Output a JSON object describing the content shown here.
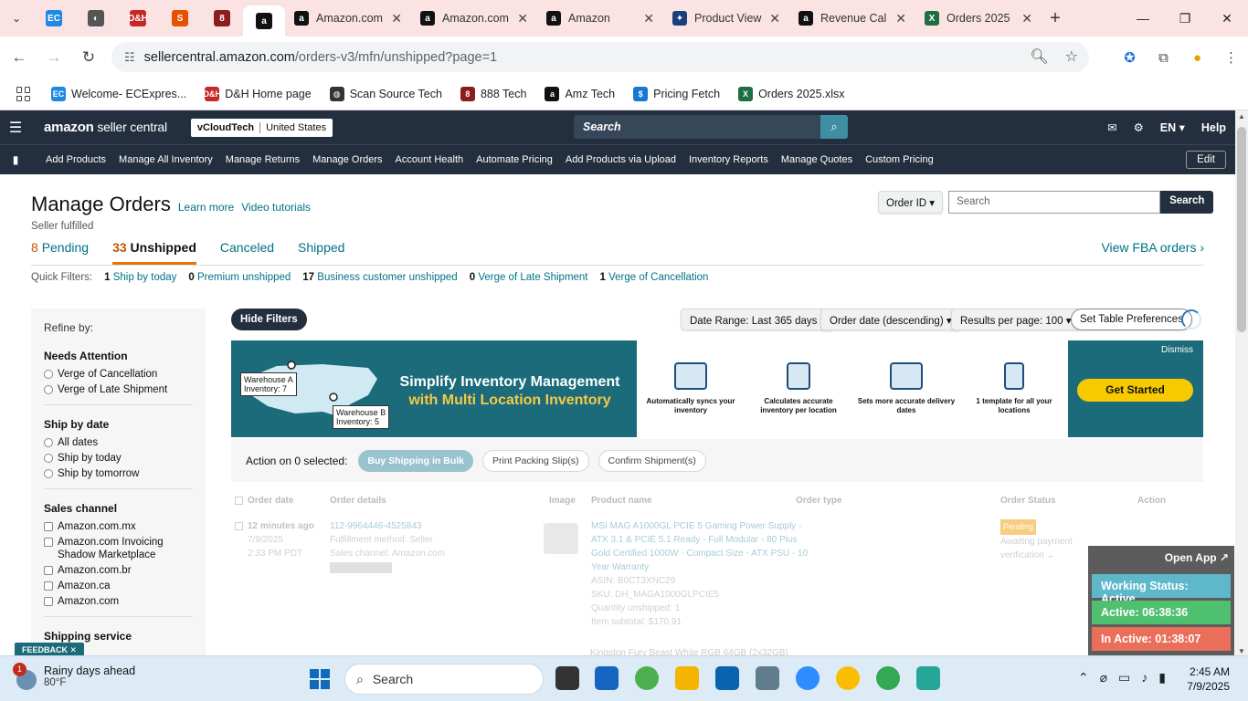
{
  "browser": {
    "pinned_tabs": [
      {
        "icon": "ecexpress-icon",
        "color": "#1e88e5",
        "glyph": "EC"
      },
      {
        "icon": "chrome-globe-icon",
        "color": "#555555",
        "glyph": "◐"
      },
      {
        "icon": "dh-icon",
        "color": "#c62828",
        "glyph": "D&H"
      },
      {
        "icon": "script-icon",
        "color": "#e65100",
        "glyph": "S"
      },
      {
        "icon": "888-icon",
        "color": "#8d1d1d",
        "glyph": "8"
      },
      {
        "icon": "amazon-icon",
        "color": "#111111",
        "glyph": "a"
      }
    ],
    "tabs": [
      {
        "title": "Amazon.com",
        "icon": "amazon-icon"
      },
      {
        "title": "Amazon.com",
        "icon": "amazon-icon"
      },
      {
        "title": "Amazon",
        "icon": "amazon-icon"
      },
      {
        "title": "Product View",
        "icon": "product-view-icon"
      },
      {
        "title": "Revenue Cal",
        "icon": "amazon-icon"
      },
      {
        "title": "Orders 2025",
        "icon": "excel-icon"
      }
    ],
    "url_host": "sellercentral.amazon.com",
    "url_path": "/orders-v3/mfn/unshipped?page=1",
    "bookmarks": [
      {
        "label": "Welcome- ECExpres...",
        "icon": "ecexpress-icon",
        "color": "#1e88e5",
        "glyph": "EC"
      },
      {
        "label": "D&H Home page",
        "icon": "dh-icon",
        "color": "#c62828",
        "glyph": "D&H"
      },
      {
        "label": "Scan Source Tech",
        "icon": "globe-icon",
        "color": "#333333",
        "glyph": "◍"
      },
      {
        "label": "888 Tech",
        "icon": "888-icon",
        "color": "#8d1d1d",
        "glyph": "8"
      },
      {
        "label": "Amz Tech",
        "icon": "amazon-icon",
        "color": "#111111",
        "glyph": "a"
      },
      {
        "label": "Pricing Fetch",
        "icon": "pricing-icon",
        "color": "#1976d2",
        "glyph": "$"
      },
      {
        "label": "Orders 2025.xlsx",
        "icon": "excel-icon",
        "color": "#1d6f42",
        "glyph": "X"
      }
    ]
  },
  "seller_central": {
    "logo_bold": "amazon",
    "logo_sub": " seller central",
    "account": "vCloudTech",
    "marketplace": "United States",
    "search_placeholder": "Search",
    "language": "EN",
    "help": "Help",
    "nav": [
      "Add Products",
      "Manage All Inventory",
      "Manage Returns",
      "Manage Orders",
      "Account Health",
      "Automate Pricing",
      "Add Products via Upload",
      "Inventory Reports",
      "Manage Quotes",
      "Custom Pricing"
    ],
    "edit": "Edit"
  },
  "page": {
    "title": "Manage Orders",
    "learn_more": "Learn more",
    "video_tutorials": "Video tutorials",
    "subtitle": "Seller fulfilled",
    "search_type": "Order ID",
    "search_placeholder": "Search",
    "search_button": "Search",
    "tabs": [
      {
        "count": "8",
        "label": "Pending"
      },
      {
        "count": "33",
        "label": "Unshipped"
      },
      {
        "count": "",
        "label": "Canceled"
      },
      {
        "count": "",
        "label": "Shipped"
      }
    ],
    "view_fba": "View FBA orders ›",
    "quick_filters_label": "Quick Filters:",
    "quick_filters": [
      {
        "count": "1",
        "label": "Ship by today"
      },
      {
        "count": "0",
        "label": "Premium unshipped"
      },
      {
        "count": "17",
        "label": "Business customer unshipped"
      },
      {
        "count": "0",
        "label": "Verge of Late Shipment"
      },
      {
        "count": "1",
        "label": "Verge of Cancellation"
      }
    ]
  },
  "sidebar": {
    "refine": "Refine by:",
    "groups": [
      {
        "title": "Needs Attention",
        "type": "radio",
        "options": [
          "Verge of Cancellation",
          "Verge of Late Shipment"
        ]
      },
      {
        "title": "Ship by date",
        "type": "radio",
        "options": [
          "All dates",
          "Ship by today",
          "Ship by tomorrow"
        ]
      },
      {
        "title": "Sales channel",
        "type": "check",
        "options": [
          "Amazon.com.mx",
          "Amazon.com Invoicing Shadow Marketplace",
          "Amazon.com.br",
          "Amazon.ca",
          "Amazon.com"
        ]
      },
      {
        "title": "Shipping service",
        "type": "check",
        "options": []
      }
    ]
  },
  "filters": {
    "hide": "Hide Filters",
    "date_range": "Date Range: Last 365 days",
    "sort": "Order date (descending)",
    "per_page": "Results per page: 100",
    "table_prefs": "Set Table Preferences"
  },
  "banner": {
    "warehouse_a": "Warehouse A\nInventory: 7",
    "warehouse_b": "Warehouse B\nInventory: 5",
    "headline_1": "Simplify Inventory Management",
    "headline_2": "with Multi Location Inventory",
    "features": [
      "Automatically syncs your inventory",
      "Calculates accurate inventory per location",
      "Sets more accurate delivery dates",
      "1 template for all your locations"
    ],
    "dismiss": "Dismiss",
    "cta": "Get Started",
    "colors": {
      "teal": "#1b6b7a",
      "cta": "#f7ca00"
    }
  },
  "actions": {
    "label": "Action on 0 selected:",
    "buy_shipping": "Buy Shipping in Bulk",
    "print_slips": "Print Packing Slip(s)",
    "confirm": "Confirm Shipment(s)"
  },
  "table": {
    "headers": [
      "Order date",
      "Order details",
      "Image",
      "Product name",
      "Order type",
      "Order Status",
      "Action"
    ],
    "rows": [
      {
        "age": "12 minutes ago",
        "date": "7/9/2025",
        "time": "2:33 PM PDT",
        "order_id": "112-9964446-4525843",
        "fulfillment": "Fulfillment method: Seller",
        "channel": "Sales channel: Amazon.com",
        "product_lines": [
          "MSI MAG A1000GL PCIE 5 Gaming Power Supply -",
          "ATX 3.1 & PCIE 5.1 Ready - Full Modular - 80 Plus",
          "Gold Certified 1000W - Compact Size - ATX PSU - 10",
          "Year Warranty"
        ],
        "asin": "ASIN: B0CT3XNC29",
        "sku": "SKU: DH_MAGA1000GLPCIE5",
        "qty": "Quantity unshipped: 1",
        "subtotal": "Item subtotal: $170.91",
        "status_badge": "Pending",
        "status_lines": [
          "Awaiting payment",
          "verification"
        ]
      }
    ],
    "next_row_partial": "Kingston Fury Beast White RGB 64GB (2x32GB)"
  },
  "feedback": "FEEDBACK",
  "tracker": {
    "open_app": "Open App ↗",
    "working": "Working Status: Active",
    "active": "Active: 06:38:36",
    "inactive": "In Active: 01:38:07"
  },
  "taskbar": {
    "weather_badge": "1",
    "weather_title": "Rainy days ahead",
    "weather_temp": "80°F",
    "search": "Search",
    "time": "2:45 AM",
    "date": "7/9/2025"
  }
}
